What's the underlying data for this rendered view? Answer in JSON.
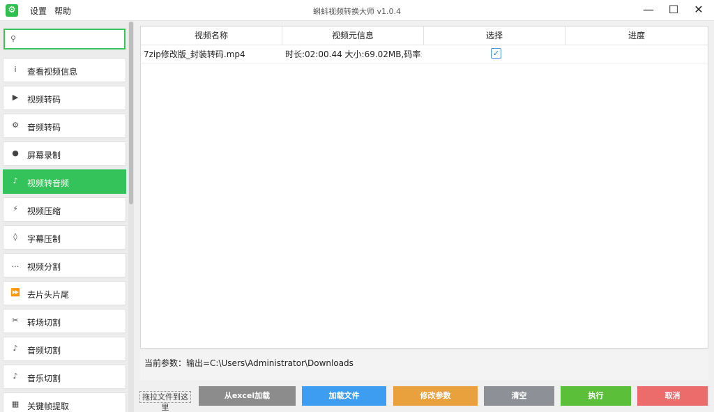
{
  "window": {
    "title": "蝌蚪视频转换大师 v1.0.4",
    "app_icon": "gear-icon",
    "menu": [
      "设置",
      "帮助"
    ],
    "controls": {
      "minimize": "—",
      "maximize": "☐",
      "close": "✕"
    }
  },
  "search": {
    "placeholder": "",
    "icon": "search-icon"
  },
  "sidebar": {
    "items": [
      {
        "label": "查看视频信息",
        "icon": "info-icon",
        "glyph": "i"
      },
      {
        "label": "视频转码",
        "icon": "play-icon",
        "glyph": "▶"
      },
      {
        "label": "音频转码",
        "icon": "settings-icon",
        "glyph": "⚙"
      },
      {
        "label": "屏幕录制",
        "icon": "record-icon",
        "glyph": "●"
      },
      {
        "label": "视频转音频",
        "icon": "music-note-icon",
        "glyph": "♪",
        "active": true
      },
      {
        "label": "视频压缩",
        "icon": "lightning-icon",
        "glyph": "⚡"
      },
      {
        "label": "字幕压制",
        "icon": "diamond-icon",
        "glyph": "◊"
      },
      {
        "label": "视频分割",
        "icon": "ellipsis-icon",
        "glyph": "…"
      },
      {
        "label": "去片头片尾",
        "icon": "fast-forward-icon",
        "glyph": "⏩"
      },
      {
        "label": "转场切割",
        "icon": "scissors-icon",
        "glyph": "✂"
      },
      {
        "label": "音频切割",
        "icon": "music-note-icon",
        "glyph": "♪"
      },
      {
        "label": "音乐切割",
        "icon": "music-note-icon",
        "glyph": "♪"
      },
      {
        "label": "关键帧提取",
        "icon": "grid-icon",
        "glyph": "▦"
      }
    ]
  },
  "table": {
    "columns": [
      "视频名称",
      "视频元信息",
      "选择",
      "进度"
    ],
    "rows": [
      {
        "name": "7zip修改版_封装转码.mp4",
        "meta": "时长:02:00.44 大小:69.02MB,码率:...",
        "selected": true,
        "progress": ""
      }
    ]
  },
  "status": {
    "params": "当前参数：输出=C:\\Users\\Administrator\\Downloads"
  },
  "footer": {
    "drop_hint": "拖拉文件到这里",
    "buttons": [
      {
        "label": "从excel加载",
        "color": "#8c8c8c"
      },
      {
        "label": "加载文件",
        "color": "#3d9df0"
      },
      {
        "label": "修改参数",
        "color": "#e8a13c"
      },
      {
        "label": "清空",
        "color": "#8d9096"
      },
      {
        "label": "执行",
        "color": "#5cbf3a"
      },
      {
        "label": "取消",
        "color": "#ec6b6b"
      }
    ]
  },
  "colors": {
    "accent": "#34c25a"
  }
}
